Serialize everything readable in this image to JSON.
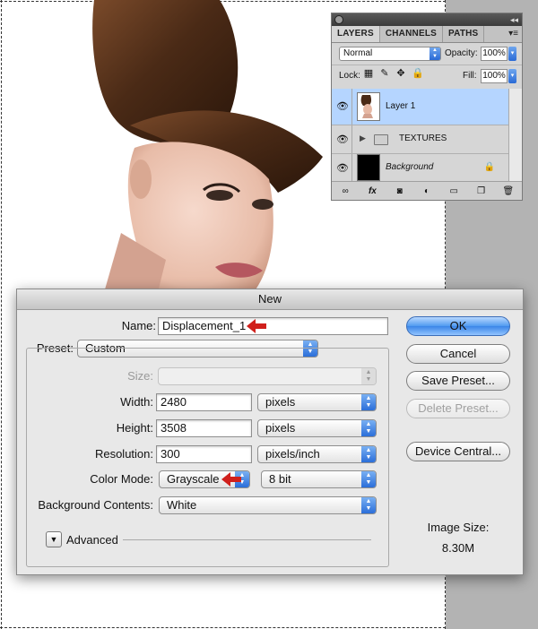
{
  "layers_panel": {
    "tabs": [
      "LAYERS",
      "CHANNELS",
      "PATHS"
    ],
    "blend_mode": "Normal",
    "opacity_label": "Opacity:",
    "opacity_value": "100%",
    "lock_label": "Lock:",
    "fill_label": "Fill:",
    "fill_value": "100%",
    "layers": [
      {
        "name": "Layer 1",
        "selected": true
      },
      {
        "name": "TEXTURES",
        "type": "group"
      },
      {
        "name": "Background",
        "locked": true
      }
    ]
  },
  "dialog": {
    "title": "New",
    "name_label": "Name:",
    "name_value": "Displacement_1",
    "preset_label": "Preset:",
    "preset_value": "Custom",
    "size_label": "Size:",
    "width_label": "Width:",
    "width_value": "2480",
    "width_unit": "pixels",
    "height_label": "Height:",
    "height_value": "3508",
    "height_unit": "pixels",
    "resolution_label": "Resolution:",
    "resolution_value": "300",
    "resolution_unit": "pixels/inch",
    "color_mode_label": "Color Mode:",
    "color_mode_value": "Grayscale",
    "bit_depth_value": "8 bit",
    "bg_contents_label": "Background Contents:",
    "bg_contents_value": "White",
    "advanced_label": "Advanced",
    "buttons": {
      "ok": "OK",
      "cancel": "Cancel",
      "save_preset": "Save Preset...",
      "delete_preset": "Delete Preset...",
      "device_central": "Device Central..."
    },
    "image_size_label": "Image Size:",
    "image_size_value": "8.30M"
  },
  "colors": {
    "accent_blue": "#3b86e8",
    "selected_layer": "#b5d5ff",
    "annotation_red": "#d0201c"
  }
}
